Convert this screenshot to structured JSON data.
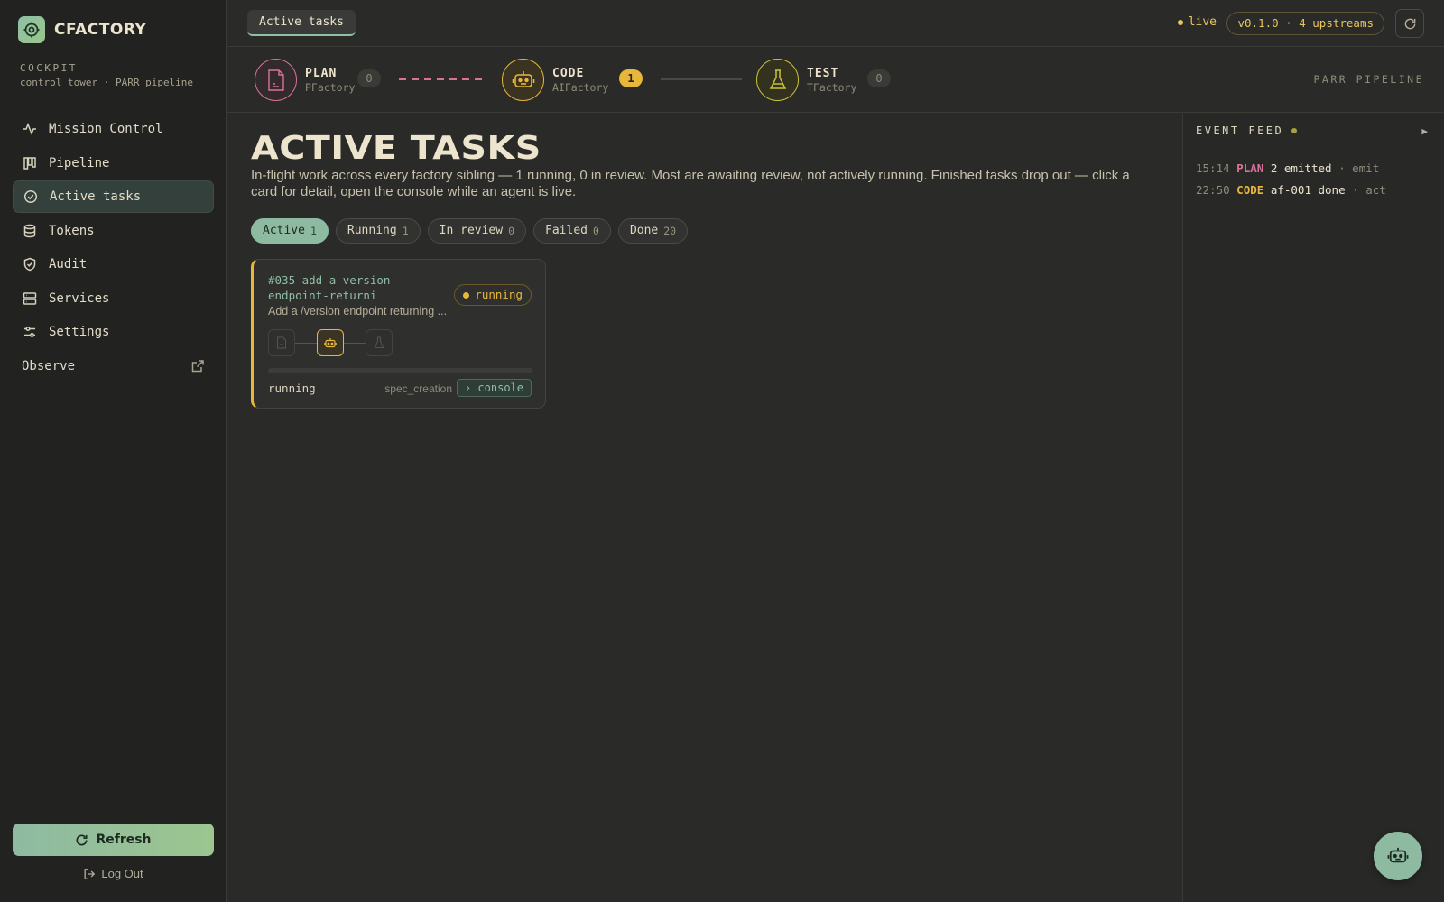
{
  "brand": {
    "name": "CFACTORY",
    "logo_icon": "target-icon"
  },
  "cockpit": {
    "title": "COCKPIT",
    "subtitle": "control tower · PARR pipeline"
  },
  "nav": {
    "items": [
      {
        "label": "Mission Control",
        "icon": "activity-icon"
      },
      {
        "label": "Pipeline",
        "icon": "kanban-icon"
      },
      {
        "label": "Active tasks",
        "icon": "check-circle-icon",
        "active": true
      },
      {
        "label": "Tokens",
        "icon": "database-icon"
      },
      {
        "label": "Audit",
        "icon": "shield-check-icon"
      },
      {
        "label": "Services",
        "icon": "server-icon"
      },
      {
        "label": "Settings",
        "icon": "sliders-icon"
      }
    ],
    "observe": {
      "label": "Observe",
      "icon": "external-link-icon"
    }
  },
  "sidebar_footer": {
    "refresh_label": "Refresh",
    "logout_label": "Log Out"
  },
  "topbar": {
    "tab_label": "Active tasks",
    "live_label": "live",
    "version_label": "v0.1.0 · 4 upstreams"
  },
  "pipeline": {
    "label": "PARR PIPELINE",
    "stages": [
      {
        "name": "PLAN",
        "sub": "PFactory",
        "count": "0",
        "color": "#d9739a"
      },
      {
        "name": "CODE",
        "sub": "AIFactory",
        "count": "1",
        "color": "#e8b73a"
      },
      {
        "name": "TEST",
        "sub": "TFactory",
        "count": "0",
        "color": "#c9c23a"
      }
    ]
  },
  "page": {
    "title": "ACTIVE TASKS",
    "description": "In-flight work across every factory sibling — 1 running, 0 in review. Most are awaiting review, not actively running. Finished tasks drop out — click a card for detail, open the console while an agent is live."
  },
  "filters": [
    {
      "label": "Active",
      "count": "1",
      "active": true
    },
    {
      "label": "Running",
      "count": "1"
    },
    {
      "label": "In review",
      "count": "0"
    },
    {
      "label": "Failed",
      "count": "0"
    },
    {
      "label": "Done",
      "count": "20"
    }
  ],
  "task_card": {
    "title": "#035-add-a-version-endpoint-returni",
    "description": "Add a /version endpoint returning ...",
    "status_pill": "running",
    "status_text": "running",
    "phase": "spec_creation",
    "console_label": "› console",
    "progress": 0,
    "accent": "#e8b73a"
  },
  "event_feed": {
    "title": "EVENT FEED",
    "toggle": "▶",
    "events": [
      {
        "time": "15:14",
        "stage": "PLAN",
        "value": "2 emitted",
        "meta": "· emit",
        "color": "#d9739a"
      },
      {
        "time": "22:50",
        "stage": "CODE",
        "value": "af-001 done",
        "meta": "· act",
        "color": "#e8b73a"
      }
    ]
  },
  "fab": {
    "icon": "robot-icon"
  }
}
